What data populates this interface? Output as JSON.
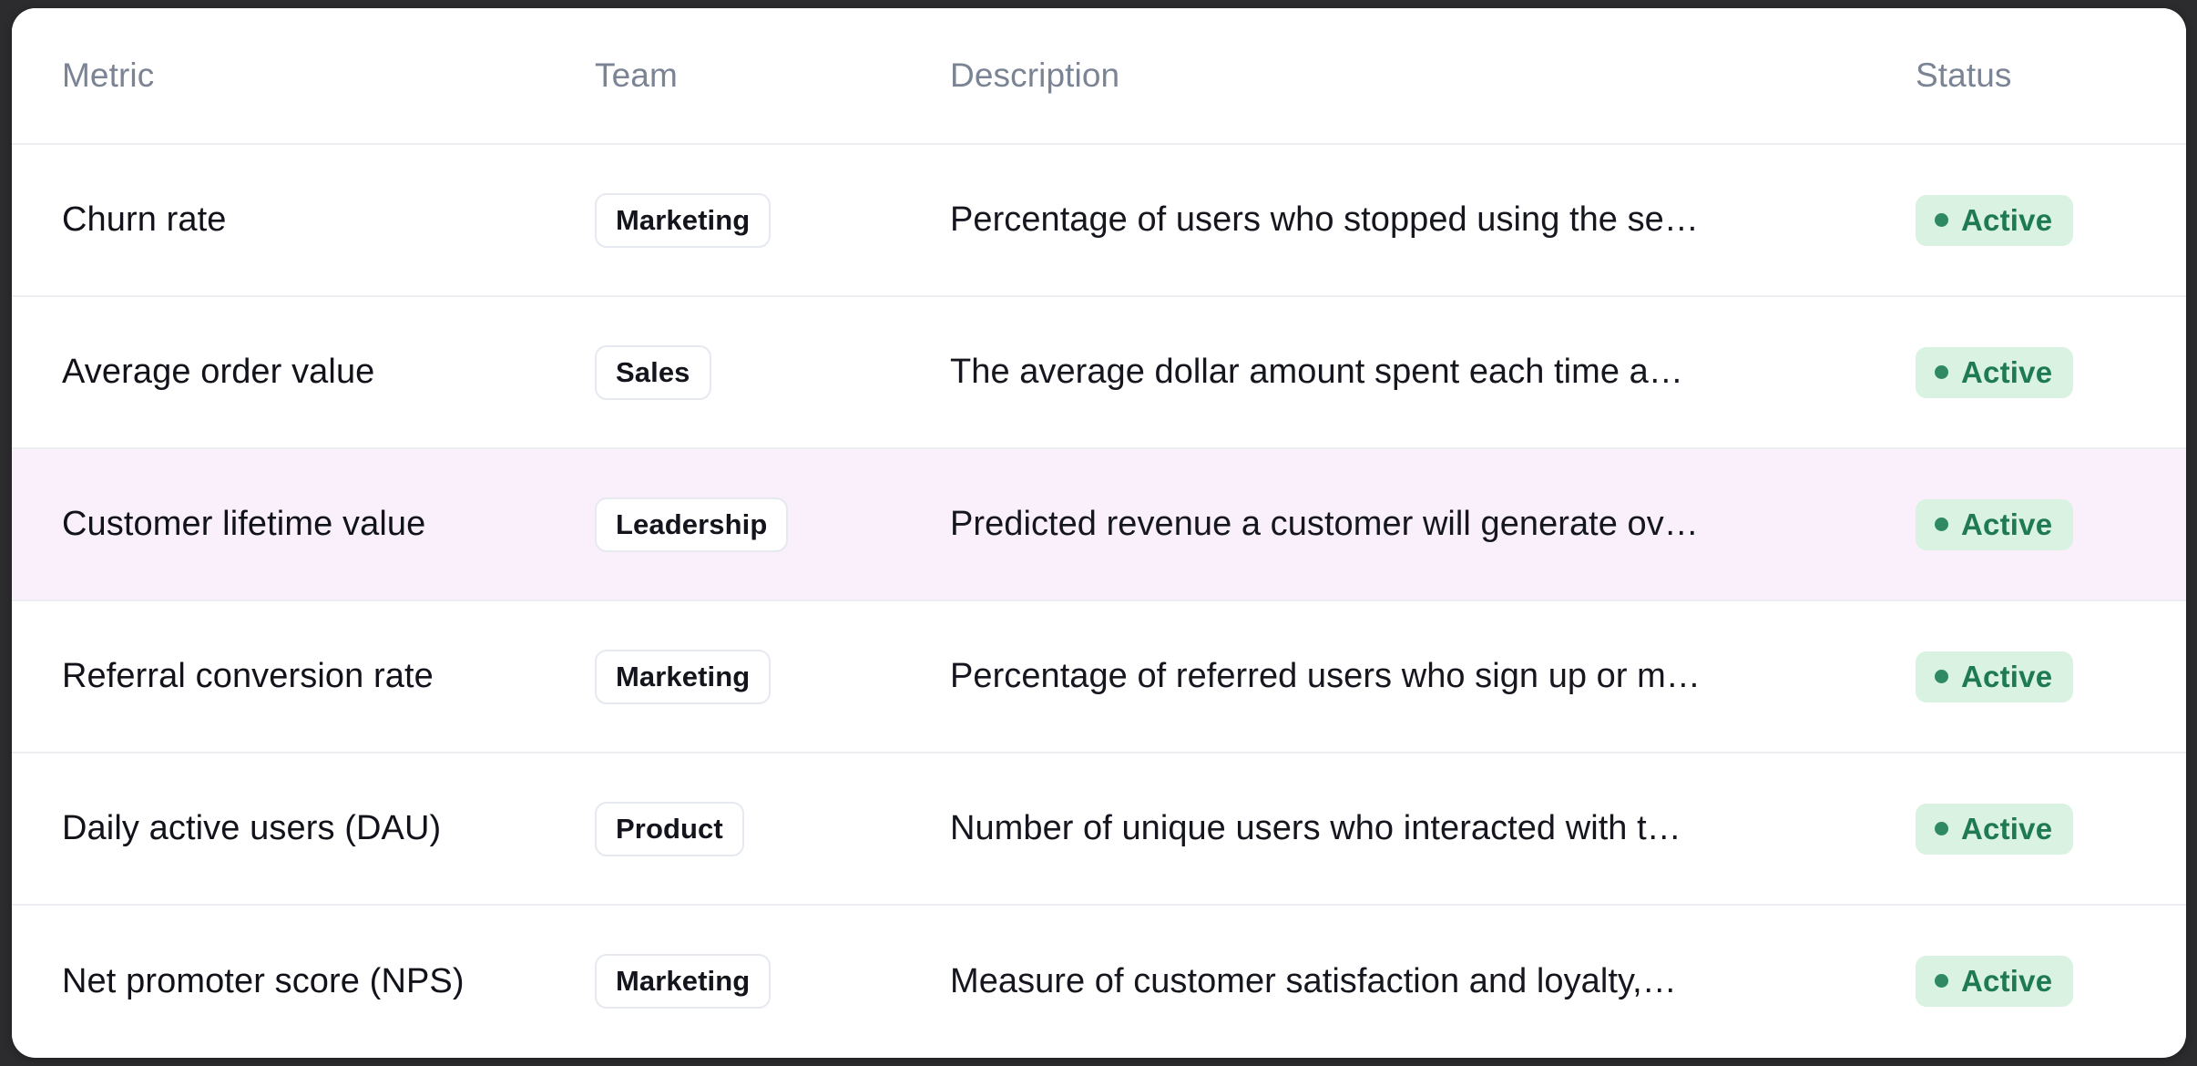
{
  "table": {
    "columns": [
      {
        "key": "metric",
        "label": "Metric"
      },
      {
        "key": "team",
        "label": "Team"
      },
      {
        "key": "description",
        "label": "Description"
      },
      {
        "key": "status",
        "label": "Status"
      }
    ],
    "rows": [
      {
        "metric": "Churn rate",
        "team": "Marketing",
        "description": "Percentage of users who stopped using the se…",
        "status": "Active",
        "highlighted": false
      },
      {
        "metric": "Average order value",
        "team": "Sales",
        "description": "The average dollar amount spent each time a…",
        "status": "Active",
        "highlighted": false
      },
      {
        "metric": "Customer lifetime value",
        "team": "Leadership",
        "description": "Predicted revenue a customer will generate ov…",
        "status": "Active",
        "highlighted": true
      },
      {
        "metric": "Referral conversion rate",
        "team": "Marketing",
        "description": "Percentage of referred users who sign up or m…",
        "status": "Active",
        "highlighted": false
      },
      {
        "metric": "Daily active users (DAU)",
        "team": "Product",
        "description": "Number of unique users who interacted with t…",
        "status": "Active",
        "highlighted": false
      },
      {
        "metric": "Net promoter score (NPS)",
        "team": "Marketing",
        "description": "Measure of customer satisfaction and loyalty,…",
        "status": "Active",
        "highlighted": false
      }
    ]
  },
  "colors": {
    "page_background": "#2c2c2e",
    "card_background": "#ffffff",
    "row_divider": "#eceef2",
    "header_text": "#7b8494",
    "body_text": "#12131a",
    "highlight_row": "#faf0fb",
    "chip_border": "#e6e9f0",
    "status_badge_background": "#d9f2e2",
    "status_text": "#1f7a52",
    "status_dot": "#2f8a61"
  }
}
